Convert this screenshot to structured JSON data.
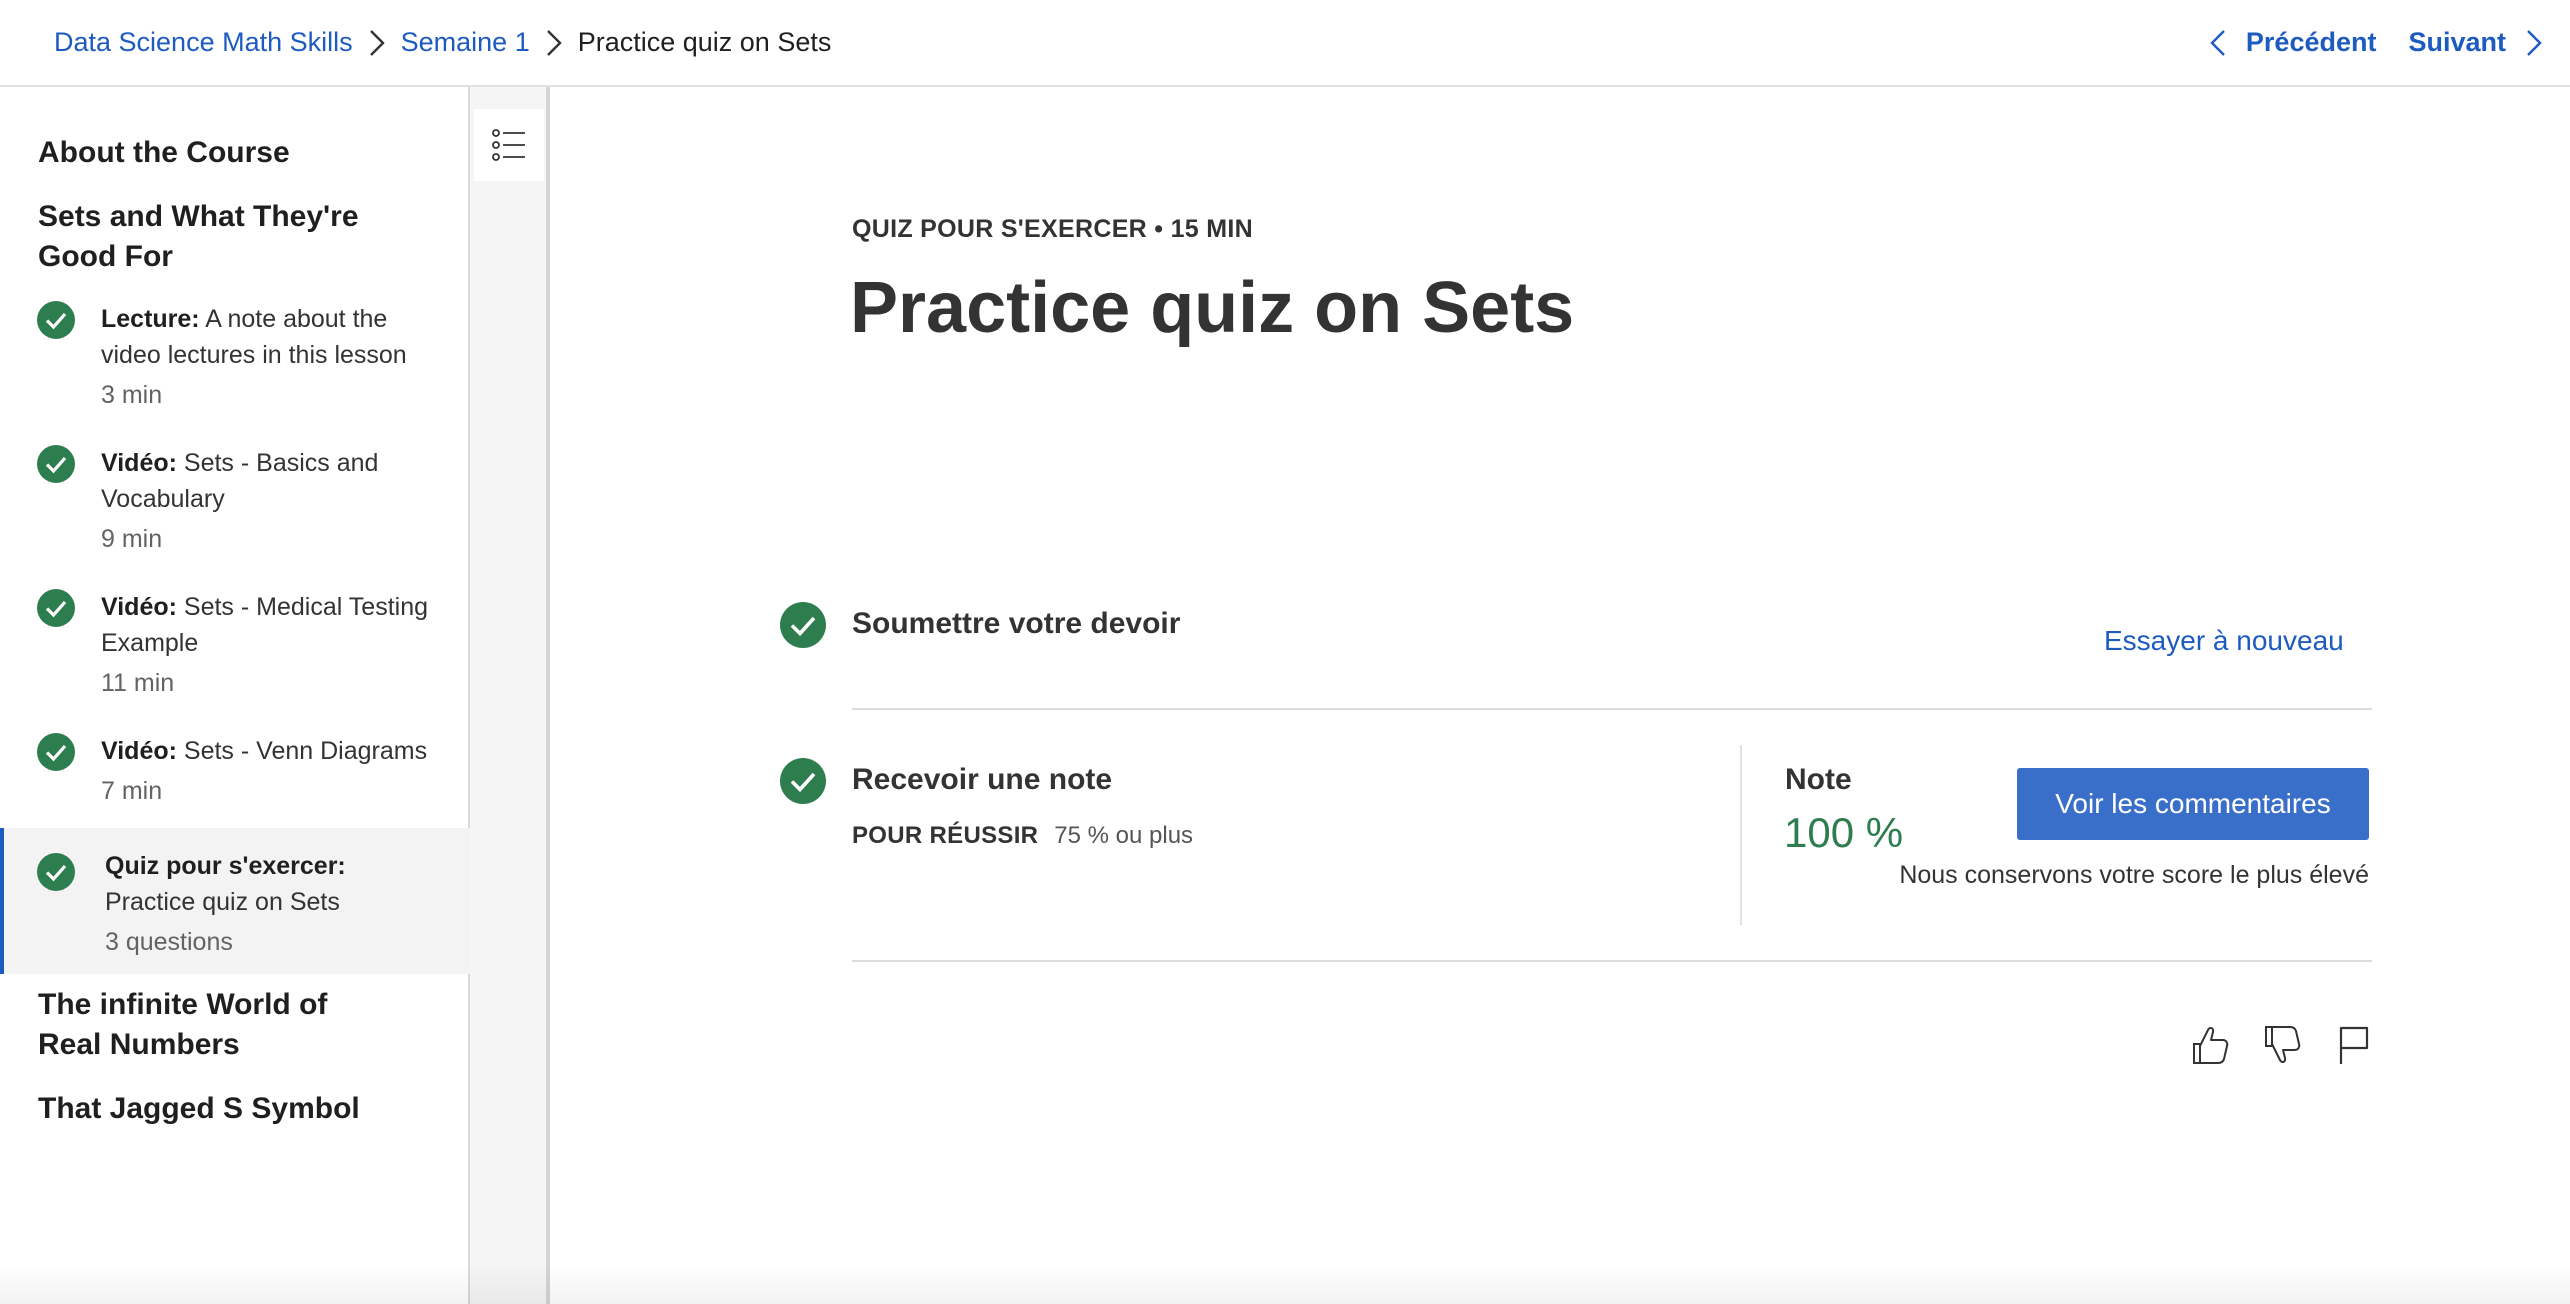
{
  "breadcrumb": {
    "course": "Data Science Math Skills",
    "week": "Semaine 1",
    "current": "Practice quiz on Sets"
  },
  "nav": {
    "prev": "Précédent",
    "next": "Suivant"
  },
  "sidebar": {
    "sections": [
      "About the Course",
      "Sets and What They're Good For",
      "The infinite World of Real Numbers",
      "That Jagged S Symbol"
    ],
    "items": [
      {
        "type": "Lecture:",
        "title": "A note about the video lectures in this lesson",
        "meta": "3 min"
      },
      {
        "type": "Vidéo:",
        "title": "Sets - Basics and Vocabulary",
        "meta": "9 min"
      },
      {
        "type": "Vidéo:",
        "title": "Sets - Medical Testing Example",
        "meta": "11 min"
      },
      {
        "type": "Vidéo:",
        "title": "Sets - Venn Diagrams",
        "meta": "7 min"
      },
      {
        "type": "Quiz pour s'exercer:",
        "title": "Practice quiz on Sets",
        "meta": "3 questions"
      }
    ]
  },
  "main": {
    "eyebrow": "QUIZ POUR S'EXERCER • 15 MIN",
    "title": "Practice quiz on Sets",
    "submit": {
      "label": "Soumettre votre devoir",
      "retry": "Essayer à nouveau"
    },
    "grade": {
      "label": "Recevoir une note",
      "pass_key": "POUR RÉUSSIR",
      "pass_value": "75 % ou plus",
      "note_label": "Note",
      "note_value": "100 %",
      "feedback_button": "Voir les commentaires",
      "keep_note": "Nous conservons votre score le plus élevé"
    }
  },
  "colors": {
    "accent": "#1d5bbf",
    "success": "#2e7d4f",
    "button": "#3a6fc9"
  }
}
